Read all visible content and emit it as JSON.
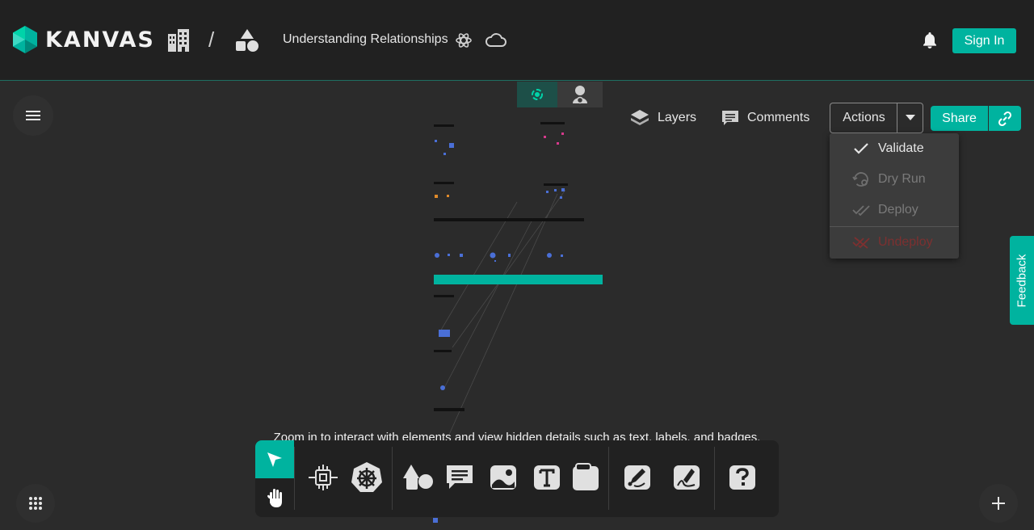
{
  "header": {
    "logo_text": "KANVAS",
    "breadcrumb_separator": "/",
    "design_title": "Understanding Relationships",
    "sign_in_label": "Sign In"
  },
  "toolbar_top": {
    "layers_label": "Layers",
    "comments_label": "Comments",
    "actions_label": "Actions",
    "share_label": "Share"
  },
  "actions_menu": {
    "items": [
      {
        "label": "Validate",
        "icon": "check-icon",
        "enabled": true
      },
      {
        "label": "Dry Run",
        "icon": "dry-run-icon",
        "enabled": false
      },
      {
        "label": "Deploy",
        "icon": "double-check-icon",
        "enabled": false
      },
      {
        "label": "Undeploy",
        "icon": "undeploy-icon",
        "enabled": false
      }
    ]
  },
  "feedback_label": "Feedback",
  "canvas_hint": "Zoom in to interact with elements and view hidden details such as text, labels, and badges.",
  "dock": {
    "tools": [
      "select-tool",
      "pan-tool",
      "component-tool",
      "kubernetes-tool",
      "shapes-tool",
      "comment-tool",
      "image-tool",
      "text-tool",
      "section-tool",
      "pen-tool",
      "freehand-tool",
      "help-tool"
    ]
  },
  "colors": {
    "accent": "#00b39f",
    "background": "#2b2b2b",
    "header": "#212121",
    "undeploy": "#8b3a3a"
  }
}
